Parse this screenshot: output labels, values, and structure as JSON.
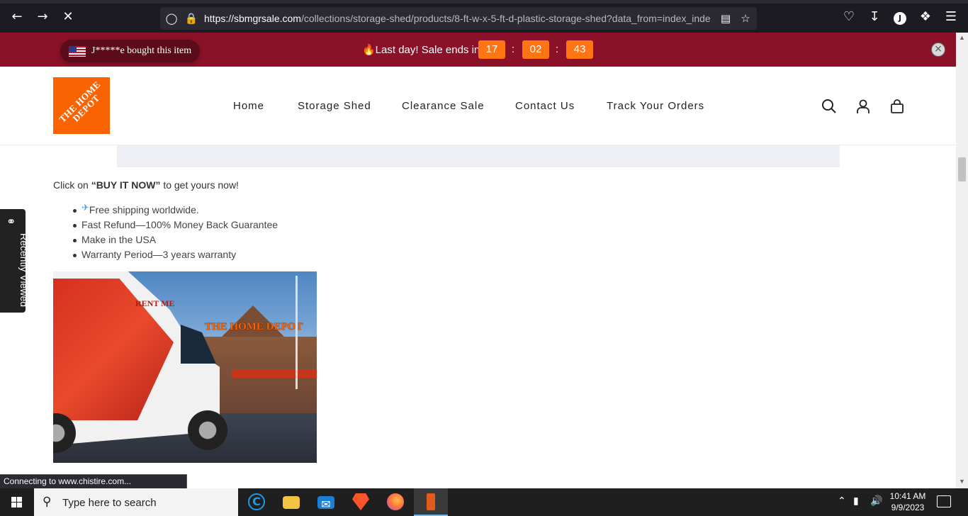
{
  "browser": {
    "url_host": "https://sbmgrsale.com",
    "url_path": "/collections/storage-shed/products/8-ft-w-x-5-ft-d-plastic-storage-shed?data_from=index_inde",
    "profile_initial": "J"
  },
  "announcement": {
    "sales_popup": "J*****e bought this item",
    "countdown_label": "🔥Last day! Sale ends in",
    "hours": "17",
    "minutes": "02",
    "seconds": "43",
    "separator": ":",
    "accent_color": "#8a1128",
    "timer_color": "#ff7514"
  },
  "header": {
    "logo_text": "THE HOME DEPOT",
    "nav": [
      "Home",
      "Storage Shed",
      "Clearance Sale",
      "Contact Us",
      "Track Your Orders"
    ]
  },
  "content": {
    "cta_prefix": "Click on ",
    "cta_bold": "“BUY IT NOW”",
    "cta_suffix": " to get yours now!",
    "plane_glyph": "✈",
    "features": [
      "Free shipping worldwide.",
      "Fast Refund—100% Money Back Guarantee",
      "Make in the USA",
      "Warranty Period—3 years warranty"
    ],
    "image": {
      "store_sign": "THE HOME DEPOT",
      "van_text": "RENT ME"
    }
  },
  "sidebar": {
    "recently_viewed": "Recently Viewed"
  },
  "status_bar": "Connecting to www.chistire.com...",
  "taskbar": {
    "search_placeholder": "Type here to search",
    "time": "10:41 AM",
    "date": "9/9/2023"
  }
}
